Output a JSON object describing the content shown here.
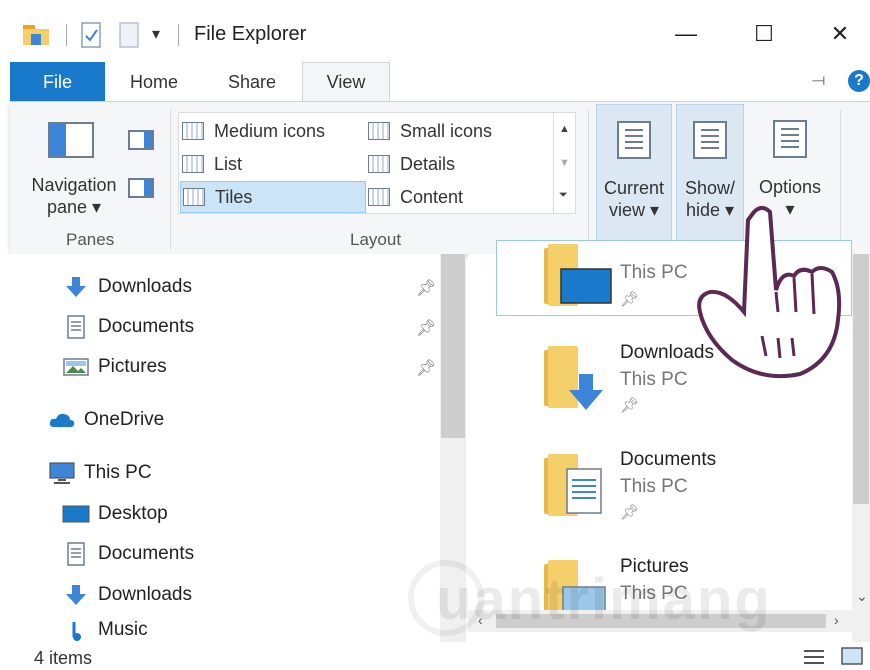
{
  "window": {
    "title": "File Explorer",
    "controls": {
      "minimize": "—",
      "maximize": "☐",
      "close": "✕"
    }
  },
  "quick_access": {
    "dropdown": "▾"
  },
  "ribbon": {
    "tabs": [
      {
        "label": "File"
      },
      {
        "label": "Home"
      },
      {
        "label": "Share"
      },
      {
        "label": "View"
      }
    ],
    "help": "?",
    "groups": {
      "panes": {
        "label": "Panes",
        "navigation_pane": "Navigation",
        "navigation_pane2": "pane ▾"
      },
      "layout": {
        "label": "Layout",
        "items": [
          {
            "label": "Medium icons"
          },
          {
            "label": "Small icons"
          },
          {
            "label": "List"
          },
          {
            "label": "Details"
          },
          {
            "label": "Tiles"
          },
          {
            "label": "Content"
          }
        ],
        "selected": "Tiles"
      },
      "current_view": {
        "line1": "Current",
        "line2": "view ▾"
      },
      "show_hide": {
        "line1": "Show/",
        "line2": "hide ▾"
      },
      "options": {
        "line1": "Options",
        "line2": "▾"
      }
    }
  },
  "nav_pane": {
    "quick_access_items": [
      {
        "label": "Downloads",
        "pinned": true
      },
      {
        "label": "Documents",
        "pinned": true
      },
      {
        "label": "Pictures",
        "pinned": true
      }
    ],
    "onedrive": "OneDrive",
    "this_pc": "This PC",
    "this_pc_items": [
      {
        "label": "Desktop"
      },
      {
        "label": "Documents"
      },
      {
        "label": "Downloads"
      },
      {
        "label": "Music"
      }
    ]
  },
  "content": {
    "tiles": [
      {
        "name": "",
        "location": "This PC"
      },
      {
        "name": "Downloads",
        "location": "This PC"
      },
      {
        "name": "Documents",
        "location": "This PC"
      },
      {
        "name": "Pictures",
        "location": "This PC"
      }
    ]
  },
  "status": {
    "count": "4 items"
  },
  "watermark": "uantrimang",
  "colors": {
    "accent": "#1979ca",
    "selection": "#cce4f7",
    "folder": "#f5cf6a"
  }
}
